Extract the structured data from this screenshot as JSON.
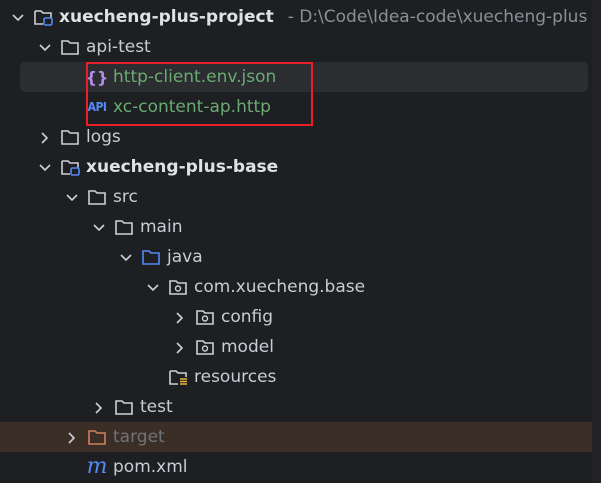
{
  "tree": [
    {
      "label": "xuecheng-plus-project",
      "path": "- D:\\Code\\Idea-code\\xuecheng-plus",
      "level": 0,
      "expanded": true,
      "type": "module",
      "bold": true
    },
    {
      "label": "api-test",
      "level": 1,
      "expanded": true,
      "type": "folder"
    },
    {
      "label": "http-client.env.json",
      "level": 2,
      "type": "json",
      "color": "#6aab73",
      "selected": true
    },
    {
      "label": "xc-content-ap.http",
      "level": 2,
      "type": "http",
      "color": "#6aab73"
    },
    {
      "label": "logs",
      "level": 1,
      "expanded": false,
      "type": "folder"
    },
    {
      "label": "xuecheng-plus-base",
      "level": 1,
      "expanded": true,
      "type": "module",
      "bold": true
    },
    {
      "label": "src",
      "level": 2,
      "expanded": true,
      "type": "folder"
    },
    {
      "label": "main",
      "level": 3,
      "expanded": true,
      "type": "folder"
    },
    {
      "label": "java",
      "level": 4,
      "expanded": true,
      "type": "source-folder"
    },
    {
      "label": "com.xuecheng.base",
      "level": 5,
      "expanded": true,
      "type": "package"
    },
    {
      "label": "config",
      "level": 6,
      "expanded": false,
      "type": "package"
    },
    {
      "label": "model",
      "level": 6,
      "expanded": false,
      "type": "package"
    },
    {
      "label": "resources",
      "level": 5,
      "type": "resources-folder"
    },
    {
      "label": "test",
      "level": 3,
      "expanded": false,
      "type": "folder"
    },
    {
      "label": "target",
      "level": 2,
      "expanded": false,
      "type": "excluded-folder",
      "excluded": true
    },
    {
      "label": "pom.xml",
      "level": 2,
      "type": "maven"
    }
  ],
  "icon_glyphs": {
    "api": "API",
    "maven": "m",
    "json": "{}"
  },
  "colors": {
    "background": "#1e1f22",
    "selection": "#2b2d30",
    "excluded": "#3b2e26",
    "highlight_box": "#e8202a",
    "file_green": "#6aab73",
    "accent_blue": "#548af7"
  }
}
